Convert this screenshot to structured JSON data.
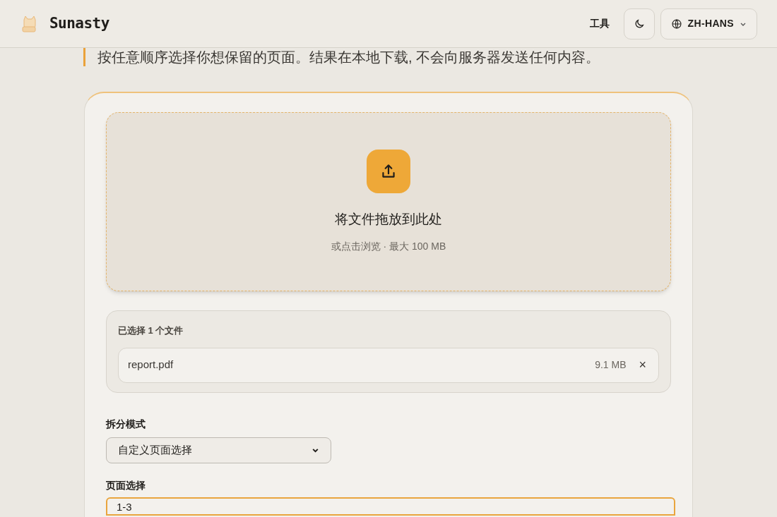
{
  "header": {
    "brand": "Sunasty",
    "nav_link": "工具",
    "dark_mode": false,
    "language": "ZH-HANS"
  },
  "description": "按任意顺序选择你想保留的页面。结果在本地下载, 不会向服务器发送任何内容。",
  "dropzone": {
    "title": "将文件拖放到此处",
    "hint": "或点击浏览 · 最大 100 MB"
  },
  "files": {
    "heading": "已选择 1 个文件",
    "items": [
      {
        "name": "report.pdf",
        "size": "9.1 MB",
        "remove": "×"
      }
    ]
  },
  "split_mode": {
    "label": "拆分模式",
    "value": "自定义页面选择"
  },
  "page_selection": {
    "label": "页面选择",
    "value": "1-3",
    "focused": true
  }
}
